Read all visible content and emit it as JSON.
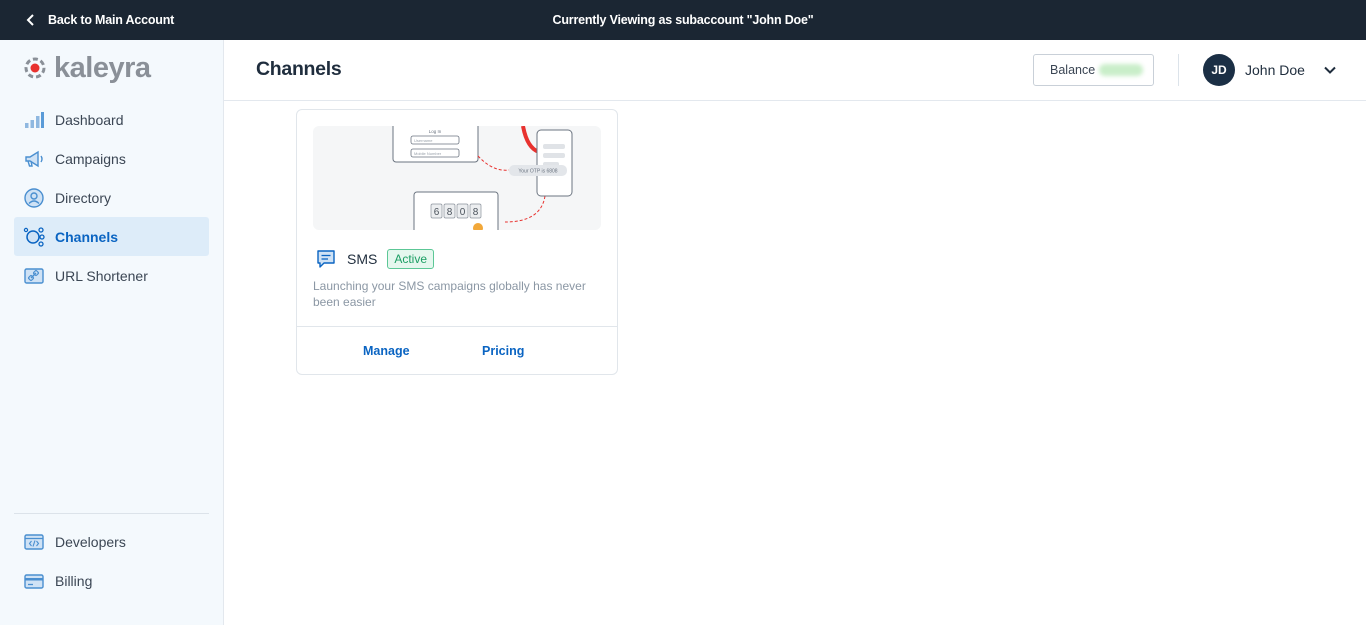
{
  "banner": {
    "back_label": "Back to Main Account",
    "viewing_label": "Currently Viewing as subaccount \"John Doe\""
  },
  "brand": {
    "name": "kaleyra",
    "accent": "#0a64c2",
    "logo_red": "#e8322f"
  },
  "sidebar": {
    "items": [
      {
        "label": "Dashboard",
        "icon": "bar-chart-icon"
      },
      {
        "label": "Campaigns",
        "icon": "megaphone-icon"
      },
      {
        "label": "Directory",
        "icon": "user-circle-icon"
      },
      {
        "label": "Channels",
        "icon": "channels-icon",
        "active": true
      },
      {
        "label": "URL Shortener",
        "icon": "link-icon"
      }
    ],
    "bottom_items": [
      {
        "label": "Developers",
        "icon": "code-icon"
      },
      {
        "label": "Billing",
        "icon": "credit-card-icon"
      }
    ]
  },
  "header": {
    "title": "Channels",
    "balance_label": "Balance",
    "balance_value": "",
    "user_initials": "JD",
    "user_name": "John Doe"
  },
  "card": {
    "title": "SMS",
    "status": "Active",
    "description": "Launching your SMS campaigns globally has never been easier",
    "manage_label": "Manage",
    "pricing_label": "Pricing",
    "illustration": {
      "login_title": "Log In",
      "username_placeholder": "Username",
      "mobile_placeholder": "Mobile Number",
      "otp_message": "Your OTP is 6808",
      "otp_digits": [
        "6",
        "8",
        "0",
        "8"
      ]
    }
  }
}
